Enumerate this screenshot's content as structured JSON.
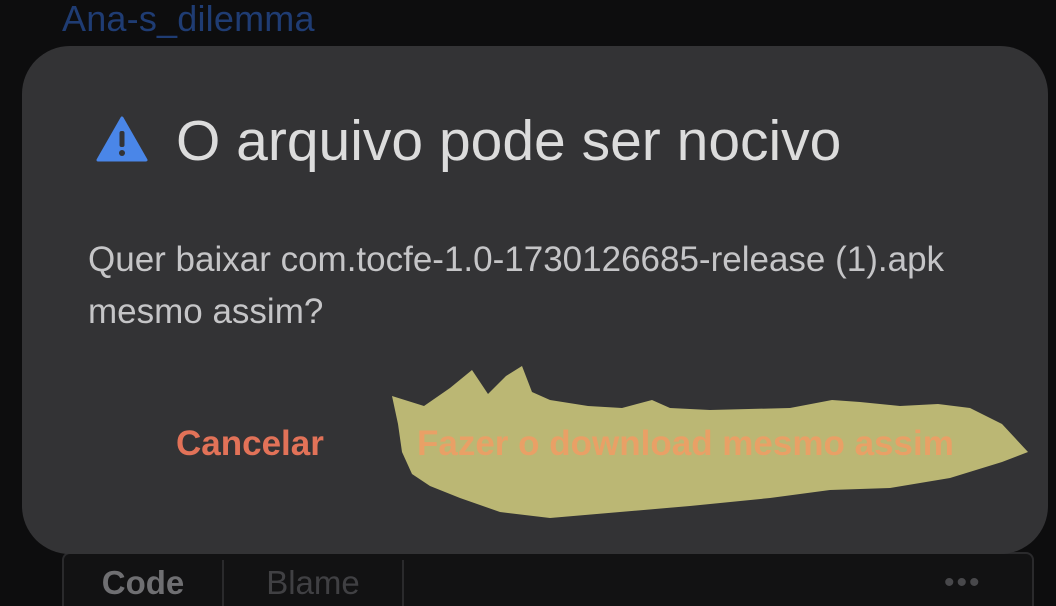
{
  "background": {
    "repo_link": "Ana-s_dilemma",
    "tabs": [
      {
        "label": "Code"
      },
      {
        "label": "Blame"
      }
    ],
    "more_icon": "more-horizontal-icon"
  },
  "dialog": {
    "icon": "warning-icon",
    "title": "O arquivo pode ser nocivo",
    "message": "Quer baixar com.tocfe-1.0-1730126685-release (1).apk mesmo assim?",
    "buttons": {
      "cancel": "Cancelar",
      "download": "Fazer o download mesmo assim"
    }
  },
  "colors": {
    "dialog_bg": "#333335",
    "cancel_text": "#e27258",
    "download_text": "#e9a066",
    "scribble": "#c6c27a",
    "warning_icon": "#4a86e8"
  }
}
